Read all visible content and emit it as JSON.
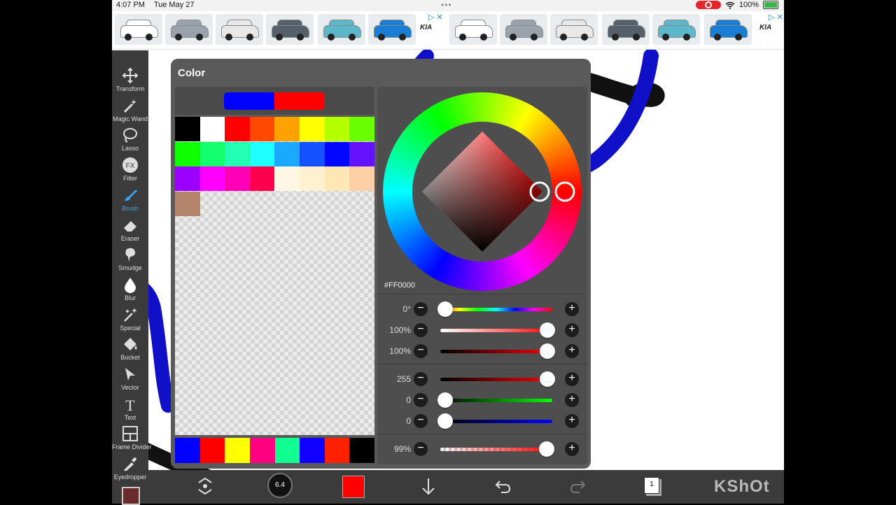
{
  "status_bar": {
    "time": "4:07 PM",
    "date": "Tue May 27",
    "battery": "100%"
  },
  "ad": {
    "brand": "KIA",
    "car_colors": [
      "#ffffff",
      "#9aa3ab",
      "#e8e8e8",
      "#55606a",
      "#5bb7c9",
      "#1a7fd4",
      "#ffffff",
      "#9aa3ab",
      "#e8e8e8",
      "#55606a",
      "#5bb7c9",
      "#1a7fd4"
    ]
  },
  "tools": [
    {
      "label": "Transform",
      "icon": "transform-icon"
    },
    {
      "label": "Magic Wand",
      "icon": "magic-wand-icon"
    },
    {
      "label": "Lasso",
      "icon": "lasso-icon"
    },
    {
      "label": "Filter",
      "icon": "fx-icon",
      "glyph": "FX"
    },
    {
      "label": "Brush",
      "icon": "brush-icon",
      "active": true
    },
    {
      "label": "Eraser",
      "icon": "eraser-icon"
    },
    {
      "label": "Smudge",
      "icon": "smudge-icon"
    },
    {
      "label": "Blur",
      "icon": "blur-drop-icon"
    },
    {
      "label": "Special",
      "icon": "special-icon"
    },
    {
      "label": "Bucket",
      "icon": "bucket-icon"
    },
    {
      "label": "Vector",
      "icon": "vector-icon"
    },
    {
      "label": "Text",
      "icon": "text-icon",
      "glyph": "T"
    },
    {
      "label": "Frame Divider",
      "icon": "frame-divider-icon"
    },
    {
      "label": "Eyedropper",
      "icon": "eyedropper-icon"
    }
  ],
  "color_panel": {
    "title": "Color",
    "current_colors": [
      "#0000ff",
      "#ff0000"
    ],
    "palette": [
      "#000000",
      "#ffffff",
      "#ff0000",
      "#ff4800",
      "#ffa100",
      "#ffff00",
      "#b4ff00",
      "#6aff00",
      "#10ff00",
      "#14ff6e",
      "#22ffb2",
      "#1effff",
      "#1aa9ff",
      "#1452ff",
      "#0006ff",
      "#6512ff",
      "#9b00ff",
      "#ff00ff",
      "#ff00b6",
      "#ff004e",
      "#fff7e6",
      "#fff0d0",
      "#ffe6b4",
      "#ffcfa8",
      "#b4856c"
    ],
    "bottom_swatches": [
      "#0000ff",
      "#ff0000",
      "#ffff00",
      "#ff0080",
      "#10ff90",
      "#1000ff",
      "#ff2000",
      "#000000"
    ],
    "hex": "#FF0000",
    "sliders": [
      {
        "label": "0°",
        "value": 0,
        "gradient": "hue"
      },
      {
        "label": "100%",
        "value": 1,
        "gradient": "saturation"
      },
      {
        "label": "100%",
        "value": 1,
        "gradient": "brightness"
      },
      {
        "label": "255",
        "value": 1,
        "gradient": "red"
      },
      {
        "label": "0",
        "value": 0,
        "gradient": "green"
      },
      {
        "label": "0",
        "value": 0,
        "gradient": "blue"
      },
      {
        "label": "99%",
        "value": 0.99,
        "gradient": "alpha"
      }
    ],
    "minus_glyph": "−",
    "plus_glyph": "+"
  },
  "bottom_bar": {
    "brush_size": "6.4",
    "layer_number": "1",
    "watermark": "KShOt"
  }
}
